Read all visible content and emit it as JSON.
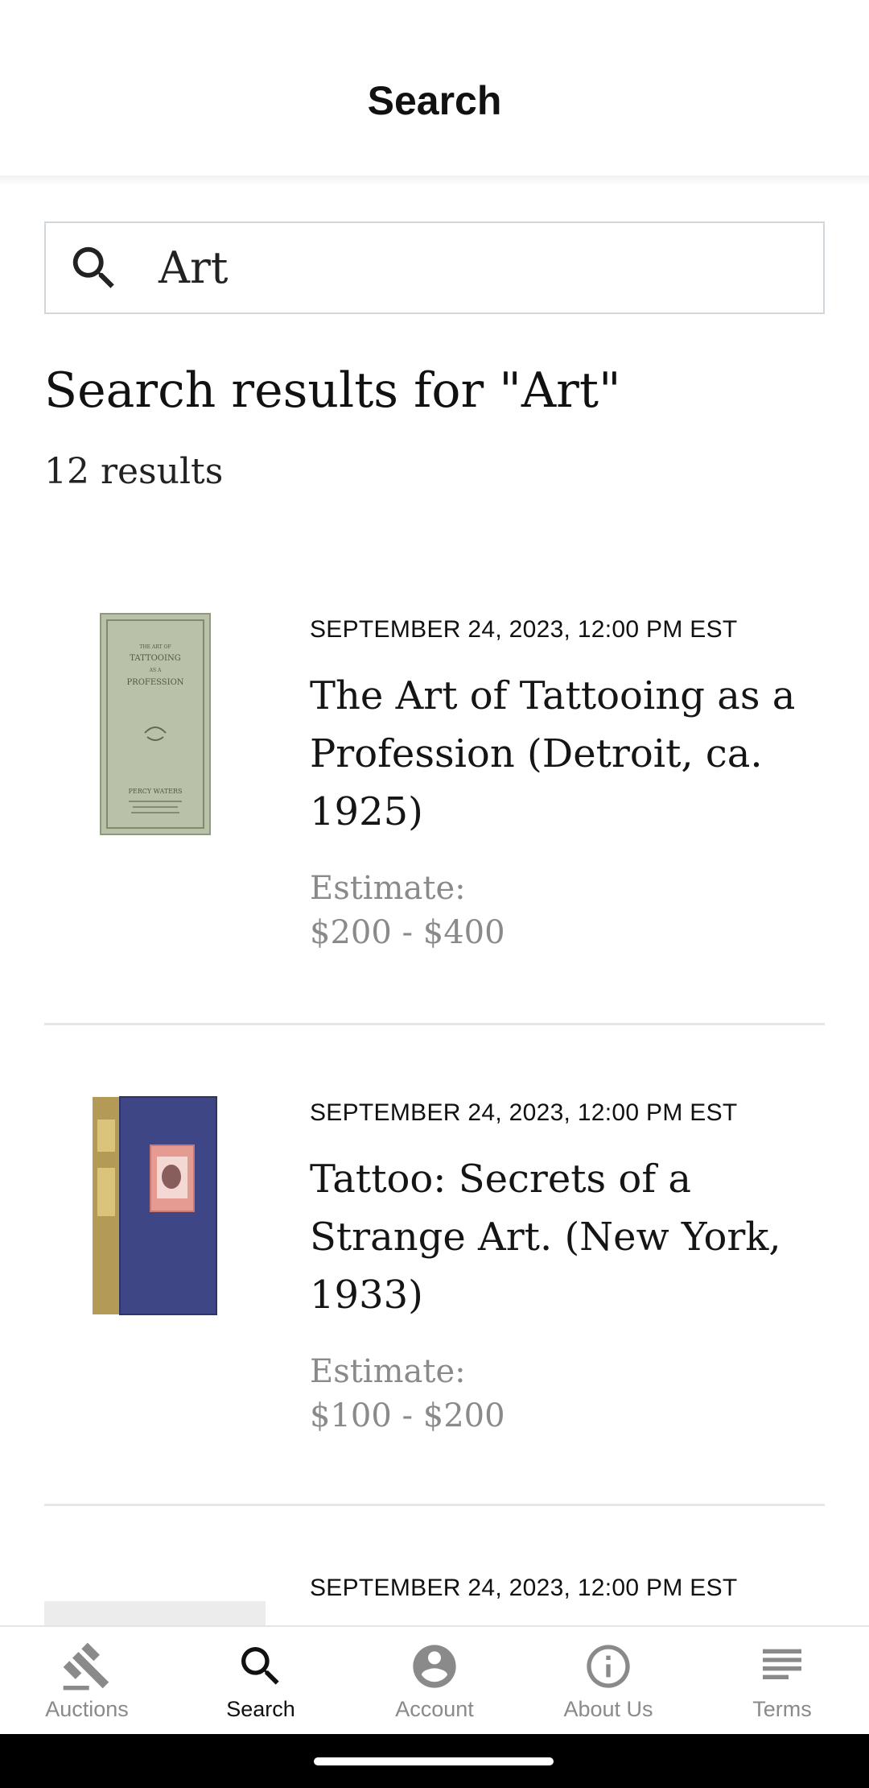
{
  "header": {
    "title": "Search"
  },
  "search": {
    "value": "Art"
  },
  "results": {
    "heading": "Search results for \"Art\"",
    "count": "12 results"
  },
  "items": [
    {
      "date": "SEPTEMBER 24, 2023, 12:00 PM EST",
      "title_lines": [
        "The Art of Tattooing as a",
        "Profession (Detroit, ca.",
        "1925)"
      ],
      "estimate_label": "Estimate:",
      "estimate_value": "$200 - $400",
      "thumb": {
        "cover_text": [
          "THE ART OF",
          "TATTOOING",
          "AS A",
          "PROFESSION",
          "PERCY WATERS"
        ]
      }
    },
    {
      "date": "SEPTEMBER 24, 2023, 12:00 PM EST",
      "title_lines": [
        "Tattoo: Secrets of a",
        "Strange Art. (New York,",
        "1933)"
      ],
      "estimate_label": "Estimate:",
      "estimate_value": "$100 - $200"
    },
    {
      "date": "SEPTEMBER 24, 2023, 12:00 PM EST"
    }
  ],
  "nav": [
    {
      "label": "Auctions",
      "icon": "gavel-icon",
      "active": false
    },
    {
      "label": "Search",
      "icon": "search-icon",
      "active": true
    },
    {
      "label": "Account",
      "icon": "account-circle-icon",
      "active": false
    },
    {
      "label": "About Us",
      "icon": "info-icon",
      "active": false
    },
    {
      "label": "Terms",
      "icon": "list-lines-icon",
      "active": false
    }
  ],
  "colors": {
    "text": "#111111",
    "muted": "#8a8a8a",
    "divider": "#e6e6e6",
    "nav_inactive": "#8a8a8a"
  }
}
